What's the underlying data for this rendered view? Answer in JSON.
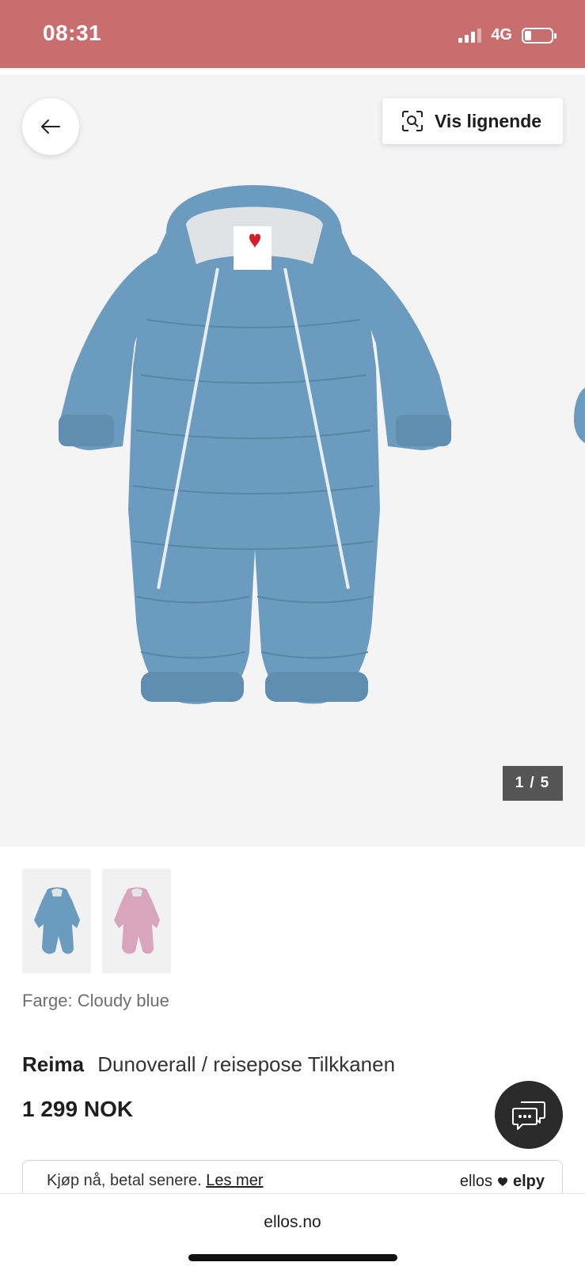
{
  "status_bar": {
    "time": "08:31",
    "network": "4G",
    "signal_bars": 3,
    "battery_level": 0.25,
    "background_color": "#c96e6f"
  },
  "gallery": {
    "back_icon": "arrow-left-icon",
    "similar_label": "Vis lignende",
    "similar_icon": "visual-search-icon",
    "counter_current": "1",
    "counter_separator": "/",
    "counter_total": "5",
    "background_color": "#f4f4f5"
  },
  "product": {
    "color_label": "Farge: Cloudy blue",
    "brand": "Reima",
    "name": "Dunoverall / reisepose Tilkkanen",
    "price": "1 299 NOK",
    "swatches": [
      {
        "color": "#6b9bbf"
      },
      {
        "color": "#d8a5bd"
      }
    ]
  },
  "chat": {
    "icon": "chat-bubbles-icon"
  },
  "pay_later": {
    "text": "Kjøp nå, betal senere.",
    "link": "Les mer",
    "brand_left": "ellos",
    "brand_right": "elpy"
  },
  "browser": {
    "url": "ellos.no"
  }
}
